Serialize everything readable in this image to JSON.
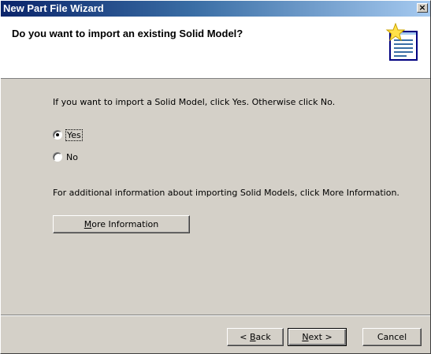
{
  "window": {
    "title": "New Part File Wizard",
    "close_glyph": "×"
  },
  "header": {
    "heading": "Do you want to import an existing Solid Model?",
    "icon": "wizard-star-document-icon"
  },
  "content": {
    "instruction": "If you want to import a Solid Model, click Yes. Otherwise click No.",
    "options": [
      {
        "label": "Yes",
        "checked": true
      },
      {
        "label": "No",
        "checked": false
      }
    ],
    "more_info_text": "For additional information about importing Solid Models, click More Information.",
    "more_info_button": {
      "mnemonic": "M",
      "rest": "ore Information"
    }
  },
  "footer": {
    "back": {
      "prefix": "< ",
      "mnemonic": "B",
      "rest": "ack"
    },
    "next": {
      "mnemonic": "N",
      "rest": "ext >"
    },
    "cancel": "Cancel"
  },
  "colors": {
    "titlebar_start": "#0a246a",
    "titlebar_end": "#a6caf0",
    "face": "#d4d0c8"
  }
}
